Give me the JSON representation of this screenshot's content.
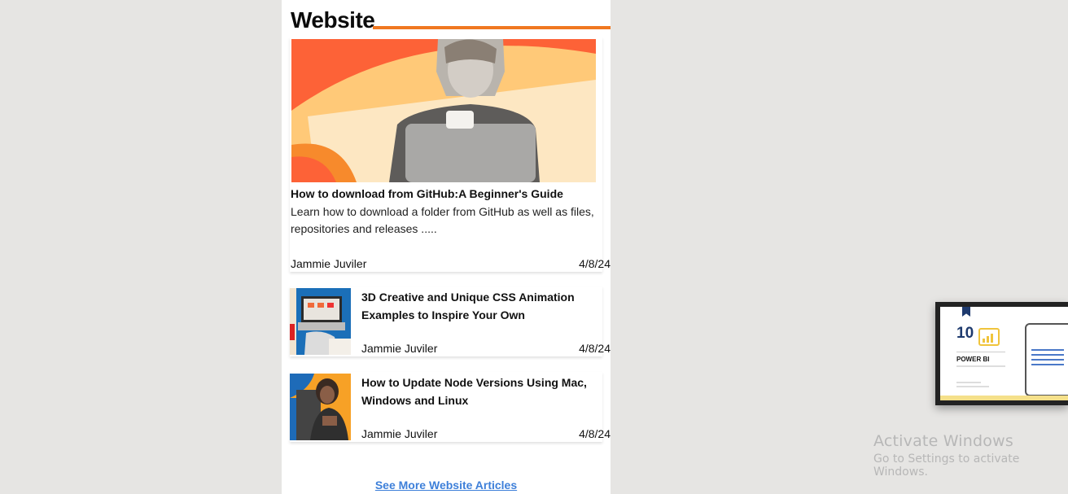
{
  "section": {
    "title": "Website"
  },
  "featured": {
    "title": "How to download from GitHub:A Beginner's Guide",
    "excerpt": "Learn how to download a folder from GitHub as well as files, repositories and releases .....",
    "author": "Jammie Juviler",
    "date": "4/8/24"
  },
  "articles": [
    {
      "title": "3D Creative and Unique CSS Animation Examples to Inspire Your Own",
      "author": "Jammie Juviler",
      "date": "4/8/24"
    },
    {
      "title": "How to Update Node Versions Using Mac, Windows and Linux",
      "author": "Jammie Juviler",
      "date": "4/8/24"
    }
  ],
  "see_more": "See More Website Articles",
  "popup": {
    "number": "10",
    "product": "POWER BI"
  },
  "windows_watermark": {
    "line1": "Activate Windows",
    "line2": "Go to Settings to activate Windows."
  },
  "colors": {
    "accent": "#f07820",
    "link": "#3d7fd9",
    "background": "#e6e5e3"
  }
}
